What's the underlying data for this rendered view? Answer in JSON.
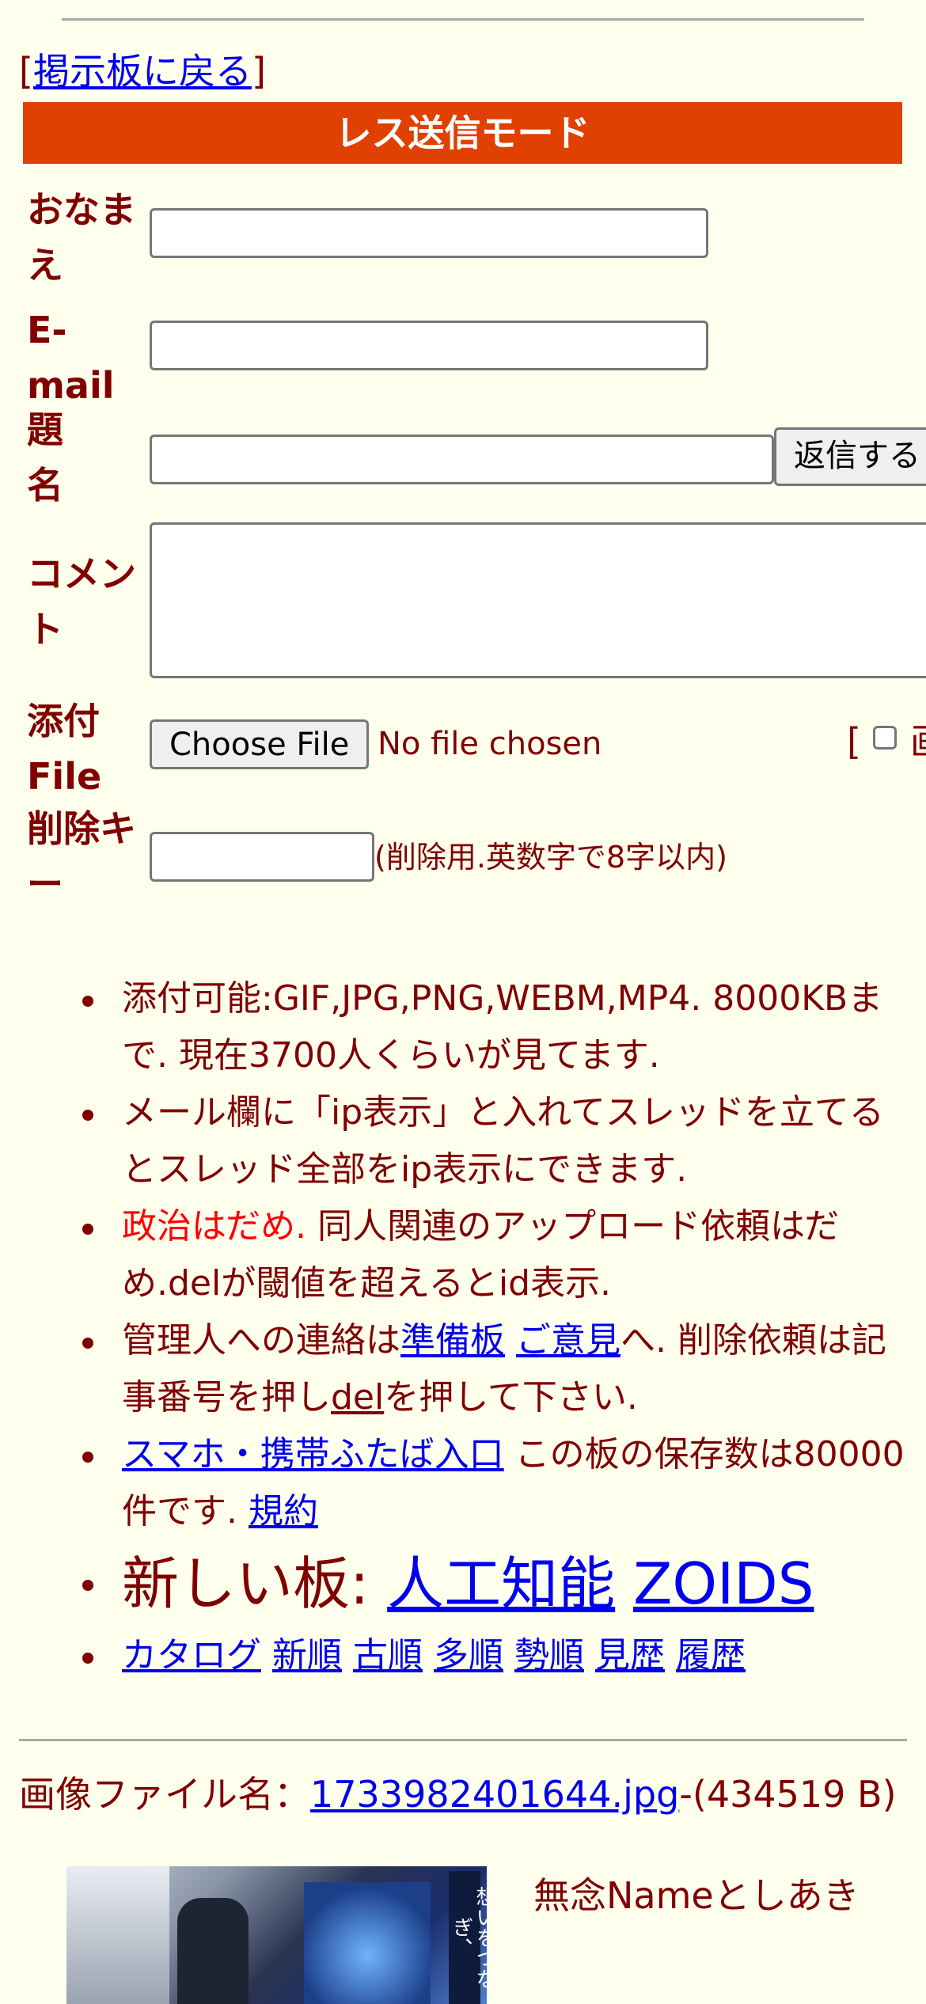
{
  "nav": {
    "back_link_open": "[",
    "back_link_label": "掲示板に戻る",
    "back_link_close": "]"
  },
  "mode_bar": {
    "title": "レス送信モード"
  },
  "form": {
    "name_label": "おなまえ",
    "email_label": "E-mail",
    "subject_label": "題名",
    "submit_label": "返信する",
    "comment_label": "コメント",
    "attach_label": "添付File",
    "choose_file_label": "Choose File",
    "no_file_text": "No file chosen",
    "attach_option_bracket": "[",
    "attach_option_clipped": "画",
    "delete_key_label": "削除キー",
    "delete_key_hint": "(削除用.英数字で8字以内)"
  },
  "notes": {
    "note1": "添付可能:GIF,JPG,PNG,WEBM,MP4. 8000KBまで. 現在3700人くらいが見てます.",
    "note2": "メール欄に「ip表示」と入れてスレッドを立てるとスレッド全部をip表示にできます.",
    "note3_red": "政治はだめ.",
    "note3_rest": " 同人関連のアップロード依頼はだめ.delが閾値を超えるとid表示.",
    "note4_pre": "管理人への連絡は",
    "note4_link1": "準備板",
    "note4_link2": "ご意見",
    "note4_mid": "へ. 削除依頼は記事番号を押し",
    "note4_link3": "del",
    "note4_post": "を押して下さい.",
    "note5_link": "スマホ・携帯ふたば入口",
    "note5_mid": " この板の保存数は80000件です. ",
    "note5_link2": "規約",
    "note6_label": "新しい板: ",
    "note6_link1": "人工知能",
    "note6_link2": "ZOIDS",
    "note7_links": [
      "カタログ",
      "新順",
      "古順",
      "多順",
      "勢順",
      "見歴",
      "履歴"
    ]
  },
  "post": {
    "file_label": "画像ファイル名：",
    "file_name": "1733982401644.jpg",
    "file_size": "-(434519 B)",
    "name_text": "無念Nameとしあき",
    "thumb_text": "想いをつなぎ、"
  }
}
